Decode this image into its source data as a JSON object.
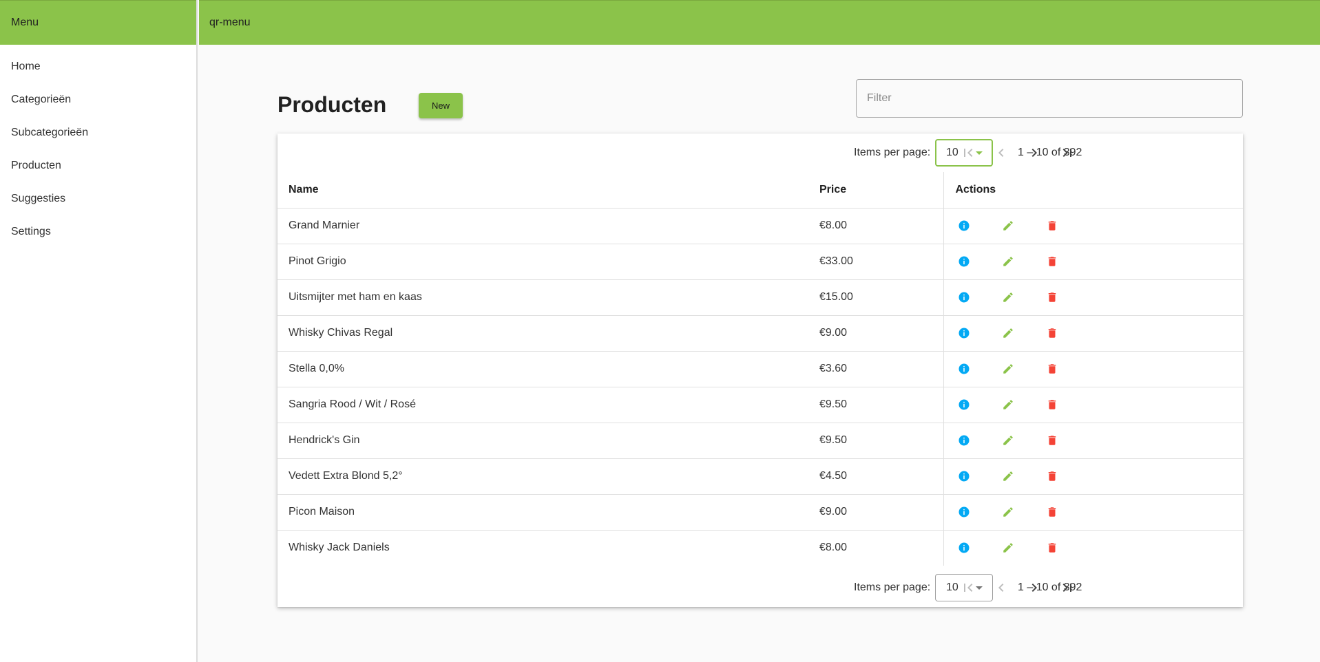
{
  "sidebar": {
    "title": "Menu",
    "items": [
      {
        "label": "Home"
      },
      {
        "label": "Categorieën"
      },
      {
        "label": "Subcategorieën"
      },
      {
        "label": "Producten"
      },
      {
        "label": "Suggesties"
      },
      {
        "label": "Settings"
      }
    ]
  },
  "toolbar": {
    "title": "qr-menu"
  },
  "page": {
    "title": "Producten",
    "new_label": "New",
    "filter_placeholder": "Filter"
  },
  "paginator": {
    "items_per_page_label": "Items per page:",
    "page_size": "10",
    "range_label": "1 – 10 of 392"
  },
  "table": {
    "headers": {
      "name": "Name",
      "price": "Price",
      "actions": "Actions"
    },
    "rows": [
      {
        "name": "Grand Marnier",
        "price": "€8.00"
      },
      {
        "name": "Pinot Grigio",
        "price": "€33.00"
      },
      {
        "name": "Uitsmijter met ham en kaas",
        "price": "€15.00"
      },
      {
        "name": "Whisky Chivas Regal",
        "price": "€9.00"
      },
      {
        "name": "Stella 0,0%",
        "price": "€3.60"
      },
      {
        "name": "Sangria Rood / Wit / Rosé",
        "price": "€9.50"
      },
      {
        "name": "Hendrick's Gin",
        "price": "€9.50"
      },
      {
        "name": "Vedett Extra Blond 5,2°",
        "price": "€4.50"
      },
      {
        "name": "Picon Maison",
        "price": "€9.00"
      },
      {
        "name": "Whisky Jack Daniels",
        "price": "€8.00"
      }
    ]
  },
  "colors": {
    "brand": "#8bc34a",
    "info": "#03a9f4",
    "edit": "#8bc34a",
    "delete": "#f44336"
  },
  "icons": {
    "info": "info-icon",
    "edit": "edit-pencil-icon",
    "delete": "delete-trash-icon",
    "first": "first-page-icon",
    "prev": "previous-page-icon",
    "next": "next-page-icon",
    "last": "last-page-icon"
  }
}
